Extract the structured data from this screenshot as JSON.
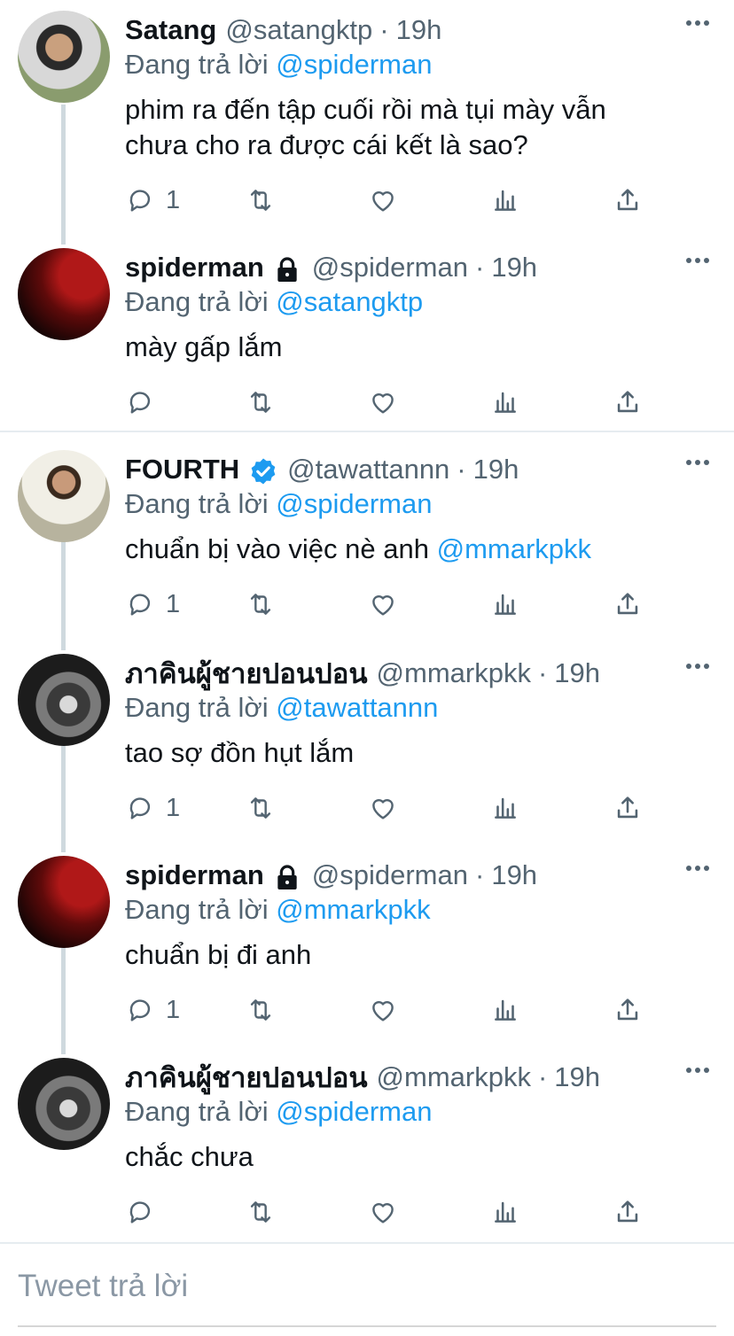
{
  "tweets": [
    {
      "name": "Satang",
      "handle": "@satangktp",
      "time": "19h",
      "replying_prefix": "Đang trả lời",
      "replying_to": "@spiderman",
      "text_lines": [
        "phim ra đến tập cuối rồi mà tụi mày vẫn",
        "chưa cho ra được cái kết là sao?"
      ],
      "mention_in_text": "",
      "reply_count": "1",
      "badge": "none"
    },
    {
      "name": "spiderman",
      "handle": "@spiderman",
      "time": "19h",
      "replying_prefix": "Đang trả lời",
      "replying_to": "@satangktp",
      "text_lines": [
        "mày gấp lắm"
      ],
      "mention_in_text": "",
      "reply_count": "",
      "badge": "lock"
    },
    {
      "name": "FOURTH",
      "handle": "@tawattannn",
      "time": "19h",
      "replying_prefix": "Đang trả lời",
      "replying_to": "@spiderman",
      "text_lines": [
        "chuẩn bị vào việc nè anh "
      ],
      "mention_in_text": "@mmarkpkk",
      "reply_count": "1",
      "badge": "verified"
    },
    {
      "name": "ภาคินผู้ชายปอนปอน",
      "handle": "@mmarkpkk",
      "time": "19h",
      "replying_prefix": "Đang trả lời",
      "replying_to": "@tawattannn",
      "text_lines": [
        "tao sợ đồn hụt lắm"
      ],
      "mention_in_text": "",
      "reply_count": "1",
      "badge": "none"
    },
    {
      "name": "spiderman",
      "handle": "@spiderman",
      "time": "19h",
      "replying_prefix": "Đang trả lời",
      "replying_to": "@mmarkpkk",
      "text_lines": [
        "chuẩn bị đi anh"
      ],
      "mention_in_text": "",
      "reply_count": "1",
      "badge": "lock"
    },
    {
      "name": "ภาคินผู้ชายปอนปอน",
      "handle": "@mmarkpkk",
      "time": "19h",
      "replying_prefix": "Đang trả lời",
      "replying_to": "@spiderman",
      "text_lines": [
        "chắc chưa"
      ],
      "mention_in_text": "",
      "reply_count": "",
      "badge": "none"
    }
  ],
  "compose": {
    "placeholder": "Tweet trả lời"
  },
  "icons": {
    "reply": "reply-icon",
    "retweet": "retweet-icon",
    "like": "heart-icon",
    "analytics": "analytics-icon",
    "share": "share-icon",
    "more": "more-icon",
    "lock": "lock-icon",
    "verified": "verified-badge-icon"
  },
  "colors": {
    "link": "#1d9bf0",
    "secondary": "#536471",
    "thread_line": "#cfd9de"
  }
}
